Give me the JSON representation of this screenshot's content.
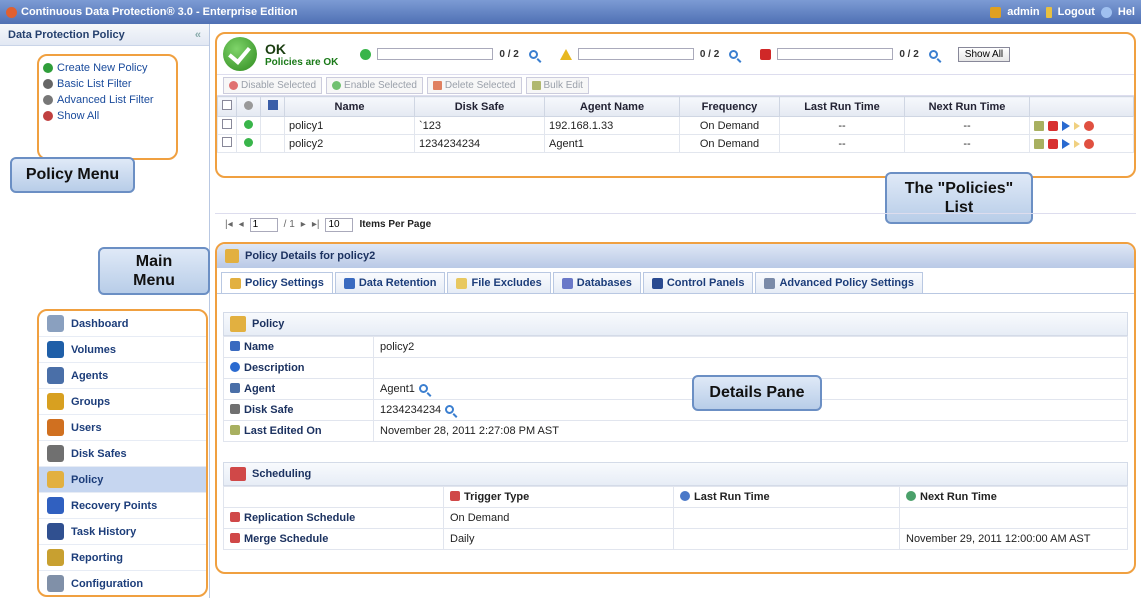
{
  "window": {
    "title": "Continuous Data Protection® 3.0 - Enterprise Edition",
    "user": "admin",
    "logout": "Logout",
    "help": "Hel"
  },
  "sidebar": {
    "header": "Data Protection Policy",
    "collapse": "«",
    "policy_menu": [
      {
        "label": "Create New Policy",
        "icon": "add-icon",
        "color": "#2f9e3a"
      },
      {
        "label": "Basic List Filter",
        "icon": "filter-icon",
        "color": "#666666"
      },
      {
        "label": "Advanced List Filter",
        "icon": "advanced-filter-icon",
        "color": "#777777"
      },
      {
        "label": "Show All",
        "icon": "show-all-icon",
        "color": "#c04040"
      }
    ],
    "main_menu": [
      {
        "label": "Dashboard",
        "icon": "dashboard-icon",
        "color": "#8aa0bf"
      },
      {
        "label": "Volumes",
        "icon": "volumes-icon",
        "color": "#1f5fa8"
      },
      {
        "label": "Agents",
        "icon": "agents-icon",
        "color": "#4a6fa8"
      },
      {
        "label": "Groups",
        "icon": "groups-icon",
        "color": "#d8a020"
      },
      {
        "label": "Users",
        "icon": "users-icon",
        "color": "#d07020"
      },
      {
        "label": "Disk Safes",
        "icon": "disk-safes-icon",
        "color": "#707070"
      },
      {
        "label": "Policy",
        "icon": "policy-icon",
        "color": "#e2b040",
        "active": true
      },
      {
        "label": "Recovery Points",
        "icon": "recovery-points-icon",
        "color": "#3060c0"
      },
      {
        "label": "Task History",
        "icon": "task-history-icon",
        "color": "#305090"
      },
      {
        "label": "Reporting",
        "icon": "reporting-icon",
        "color": "#c8a030"
      },
      {
        "label": "Configuration",
        "icon": "configuration-icon",
        "color": "#8090a8"
      }
    ]
  },
  "callouts": {
    "policy_menu": "Policy Menu",
    "main_menu": "Main Menu",
    "policies_list": "The \"Policies\" List",
    "details_pane": "Details Pane"
  },
  "status": {
    "title": "OK",
    "subtitle": "Policies are OK",
    "ok_count": "0 / 2",
    "warn_count": "0 / 2",
    "error_count": "0 / 2",
    "show_all": "Show All"
  },
  "toolbar": {
    "disable": "Disable Selected",
    "enable": "Enable Selected",
    "delete": "Delete Selected",
    "bulk": "Bulk Edit"
  },
  "grid": {
    "columns": [
      "Name",
      "Disk Safe",
      "Agent Name",
      "Frequency",
      "Last Run Time",
      "Next Run Time"
    ],
    "rows": [
      {
        "name": "policy1",
        "disk_safe": "`123",
        "agent": "192.168.1.33",
        "frequency": "On Demand",
        "last_run": "--",
        "next_run": "--"
      },
      {
        "name": "policy2",
        "disk_safe": "1234234234",
        "agent": "Agent1",
        "frequency": "On Demand",
        "last_run": "--",
        "next_run": "--"
      }
    ]
  },
  "pager": {
    "page": "1",
    "of": "/ 1",
    "per_page": "10",
    "label": "Items Per Page"
  },
  "details": {
    "header": "Policy Details for policy2",
    "tabs": [
      "Policy Settings",
      "Data Retention",
      "File Excludes",
      "Databases",
      "Control Panels",
      "Advanced Policy Settings"
    ],
    "policy_section": "Policy",
    "fields": [
      {
        "key": "Name",
        "value": "policy2",
        "mag": false
      },
      {
        "key": "Description",
        "value": "",
        "mag": false
      },
      {
        "key": "Agent",
        "value": "Agent1",
        "mag": true
      },
      {
        "key": "Disk Safe",
        "value": "1234234234",
        "mag": true
      },
      {
        "key": "Last Edited On",
        "value": "November 28, 2011 2:27:08 PM AST",
        "mag": false
      }
    ],
    "scheduling_section": "Scheduling",
    "schedule_columns": [
      "Trigger Type",
      "Last Run Time",
      "Next Run Time"
    ],
    "schedules": [
      {
        "name": "Replication Schedule",
        "trigger": "On Demand",
        "last": "",
        "next": ""
      },
      {
        "name": "Merge Schedule",
        "trigger": "Daily",
        "last": "",
        "next": "November 29, 2011 12:00:00 AM AST"
      }
    ]
  }
}
